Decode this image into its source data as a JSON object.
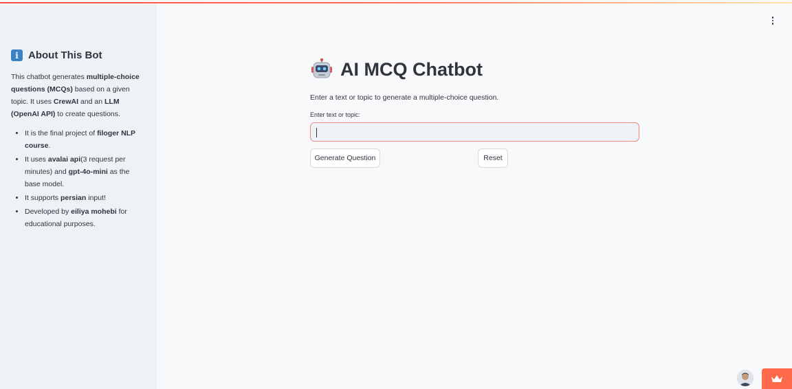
{
  "sidebar": {
    "title": "About This Bot",
    "info_icon": "info-icon",
    "intro": {
      "t1": "This chatbot generates ",
      "b1": "multiple-choice questions (MCQs)",
      "t2": " based on a given topic. It uses ",
      "b2": "CrewAI",
      "t3": " and an ",
      "b3": "LLM (OpenAI API)",
      "t4": " to create questions."
    },
    "bullets": [
      {
        "t1": "It is the final project of ",
        "b1": "filoger NLP course",
        "t2": "."
      },
      {
        "t1": "It uses ",
        "b1": "avalai api",
        "t2": "(3 request per minutes) and ",
        "b2": "gpt-4o-mini",
        "t3": " as the base model."
      },
      {
        "t1": "It supports ",
        "b1": "persian",
        "t2": " input!"
      },
      {
        "t1": "Developed by ",
        "b1": "eiliya mohebi",
        "t2": " for educational purposes."
      }
    ]
  },
  "main": {
    "title": "AI MCQ Chatbot",
    "title_icon": "robot-icon",
    "subtitle": "Enter a text or topic to generate a multiple-choice question.",
    "input_label": "Enter text or topic:",
    "input_value": "",
    "generate_label": "Generate Question",
    "reset_label": "Reset"
  },
  "header": {
    "menu_icon": "kebab-menu-icon"
  },
  "footer": {
    "avatar": "avatar",
    "crown_icon": "crown-icon"
  },
  "colors": {
    "accent": "#ff4b4b",
    "sidebar_bg": "#eef1f5",
    "input_border": "#ef8c7f",
    "crown_bg": "#ff6b4a"
  }
}
